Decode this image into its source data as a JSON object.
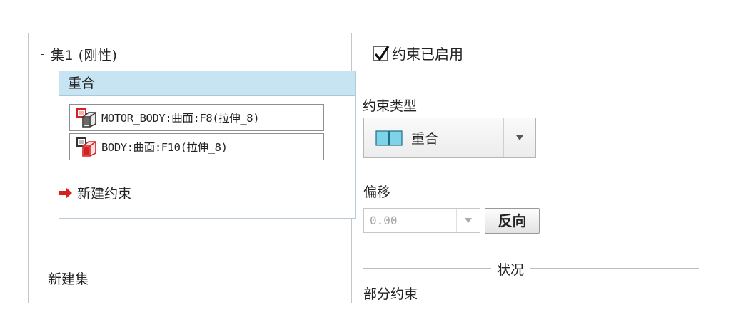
{
  "tree": {
    "set_label": "集1 (刚性)",
    "constraint": {
      "header": "重合",
      "refs": [
        {
          "text": "MOTOR_BODY:曲面:F8(拉伸_8)"
        },
        {
          "text": "BODY:曲面:F10(拉伸_8)"
        }
      ]
    },
    "new_constraint": "新建约束",
    "new_set": "新建集"
  },
  "properties": {
    "enabled_label": "约束已启用",
    "enabled": true,
    "type_label": "约束类型",
    "type_value": "重合",
    "offset_label": "偏移",
    "offset_value": "0.00",
    "flip_label": "反向",
    "status_title": "状况",
    "status_value": "部分约束"
  },
  "colors": {
    "selected_header": "#c7e4f3",
    "arrow": "#d8201c",
    "type_icon": "#7fd3e8"
  }
}
